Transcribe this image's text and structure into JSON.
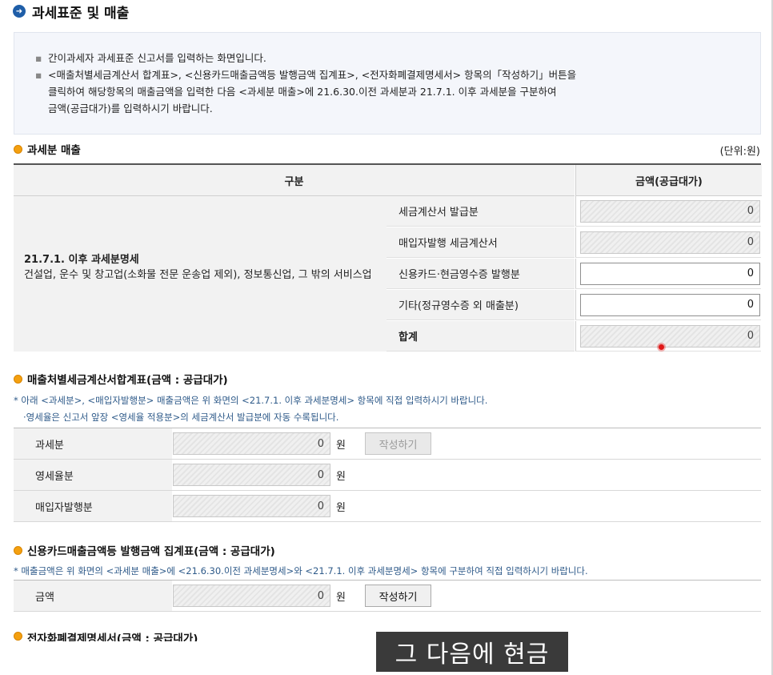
{
  "page_title": "과세표준 및 매출",
  "info": {
    "line1": "간이과세자 과세표준 신고서를 입력하는 화면입니다.",
    "line2a": "<매출처별세금계산서 합계표>, <신용카드매출금액등 발행금액 집계표>, <전자화폐결제명세서> 항목의「작성하기」버튼을",
    "line2b": "클릭하여 해당항목의 매출금액을 입력한 다음 <과세분 매출>에 21.6.30.이전 과세분과 21.7.1. 이후 과세분을 구분하여",
    "line2c": "금액(공급대가)를 입력하시기 바랍니다."
  },
  "taxable_sales": {
    "title": "과세분 매출",
    "unit": "(단위:원)",
    "header_category": "구분",
    "header_amount": "금액(공급대가)",
    "group_title": "21.7.1. 이후 과세분명세",
    "group_desc": "건설업, 운수 및 창고업(소화물 전문 운송업 제외), 정보통신업, 그 밖의 서비스업",
    "rows": [
      {
        "label": "세금계산서 발급분",
        "value": "0"
      },
      {
        "label": "매입자발행 세금계산서",
        "value": "0"
      },
      {
        "label": "신용카드·현금영수증 발행분",
        "value": "0"
      },
      {
        "label": "기타(정규영수증 외 매출분)",
        "value": "0"
      },
      {
        "label": "합계",
        "value": "0"
      }
    ]
  },
  "invoice_summary": {
    "title": "매출처별세금계산서합계표(금액 : 공급대가)",
    "note1": "* 아래 <과세분>, <매입자발행분> 매출금액은 위 화면의 <21.7.1. 이후 과세분명세> 항목에 직접 입력하시기 바랍니다.",
    "note2": "·영세율은 신고서 앞장 <영세율 적용분>의 세금계산서 발급분에 자동 수록됩니다.",
    "rows": [
      {
        "label": "과세분",
        "value": "0",
        "unit": "원"
      },
      {
        "label": "영세율분",
        "value": "0",
        "unit": "원"
      },
      {
        "label": "매입자발행분",
        "value": "0",
        "unit": "원"
      }
    ],
    "write_button": "작성하기"
  },
  "card_summary": {
    "title": "신용카드매출금액등 발행금액 집계표(금액 : 공급대가)",
    "note": "* 매출금액은 위 화면의 <과세분 매출>에 <21.6.30.이전 과세분명세>와 <21.7.1. 이후 과세분명세> 항목에 구분하여 직접 입력하시기 바랍니다.",
    "label": "금액",
    "value": "0",
    "unit": "원",
    "write_button": "작성하기"
  },
  "emoney": {
    "title": "전자화폐결제명세서(금액 : 공급대가)"
  },
  "caption": "그 다음에 현금"
}
